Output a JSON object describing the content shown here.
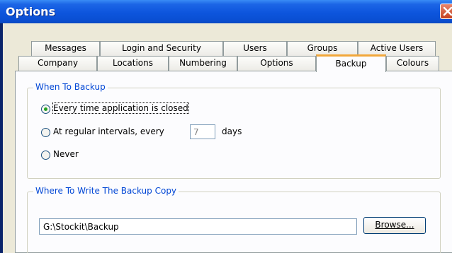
{
  "window": {
    "title": "Options"
  },
  "tabs": {
    "row1": [
      "Messages",
      "Login and Security",
      "Users",
      "Groups",
      "Active Users"
    ],
    "row2": [
      "Company",
      "Locations",
      "Numbering",
      "Options",
      "Backup",
      "Colours"
    ],
    "active": "Backup"
  },
  "when_to_backup": {
    "title": "When To Backup",
    "options": [
      {
        "label": "Every time application is closed",
        "selected": true
      },
      {
        "label": "At regular intervals, every",
        "selected": false
      },
      {
        "label": "Never",
        "selected": false
      }
    ],
    "interval_value": "7",
    "interval_unit": "days"
  },
  "where_to_write": {
    "title": "Where To Write The Backup Copy",
    "path_value": "G:\\Stockit\\Backup",
    "browse_label": "Browse..."
  },
  "colors": {
    "accent": "#0046d5",
    "active_tab_highlight": "#f2a73a",
    "radio_selected": "#21a121"
  }
}
